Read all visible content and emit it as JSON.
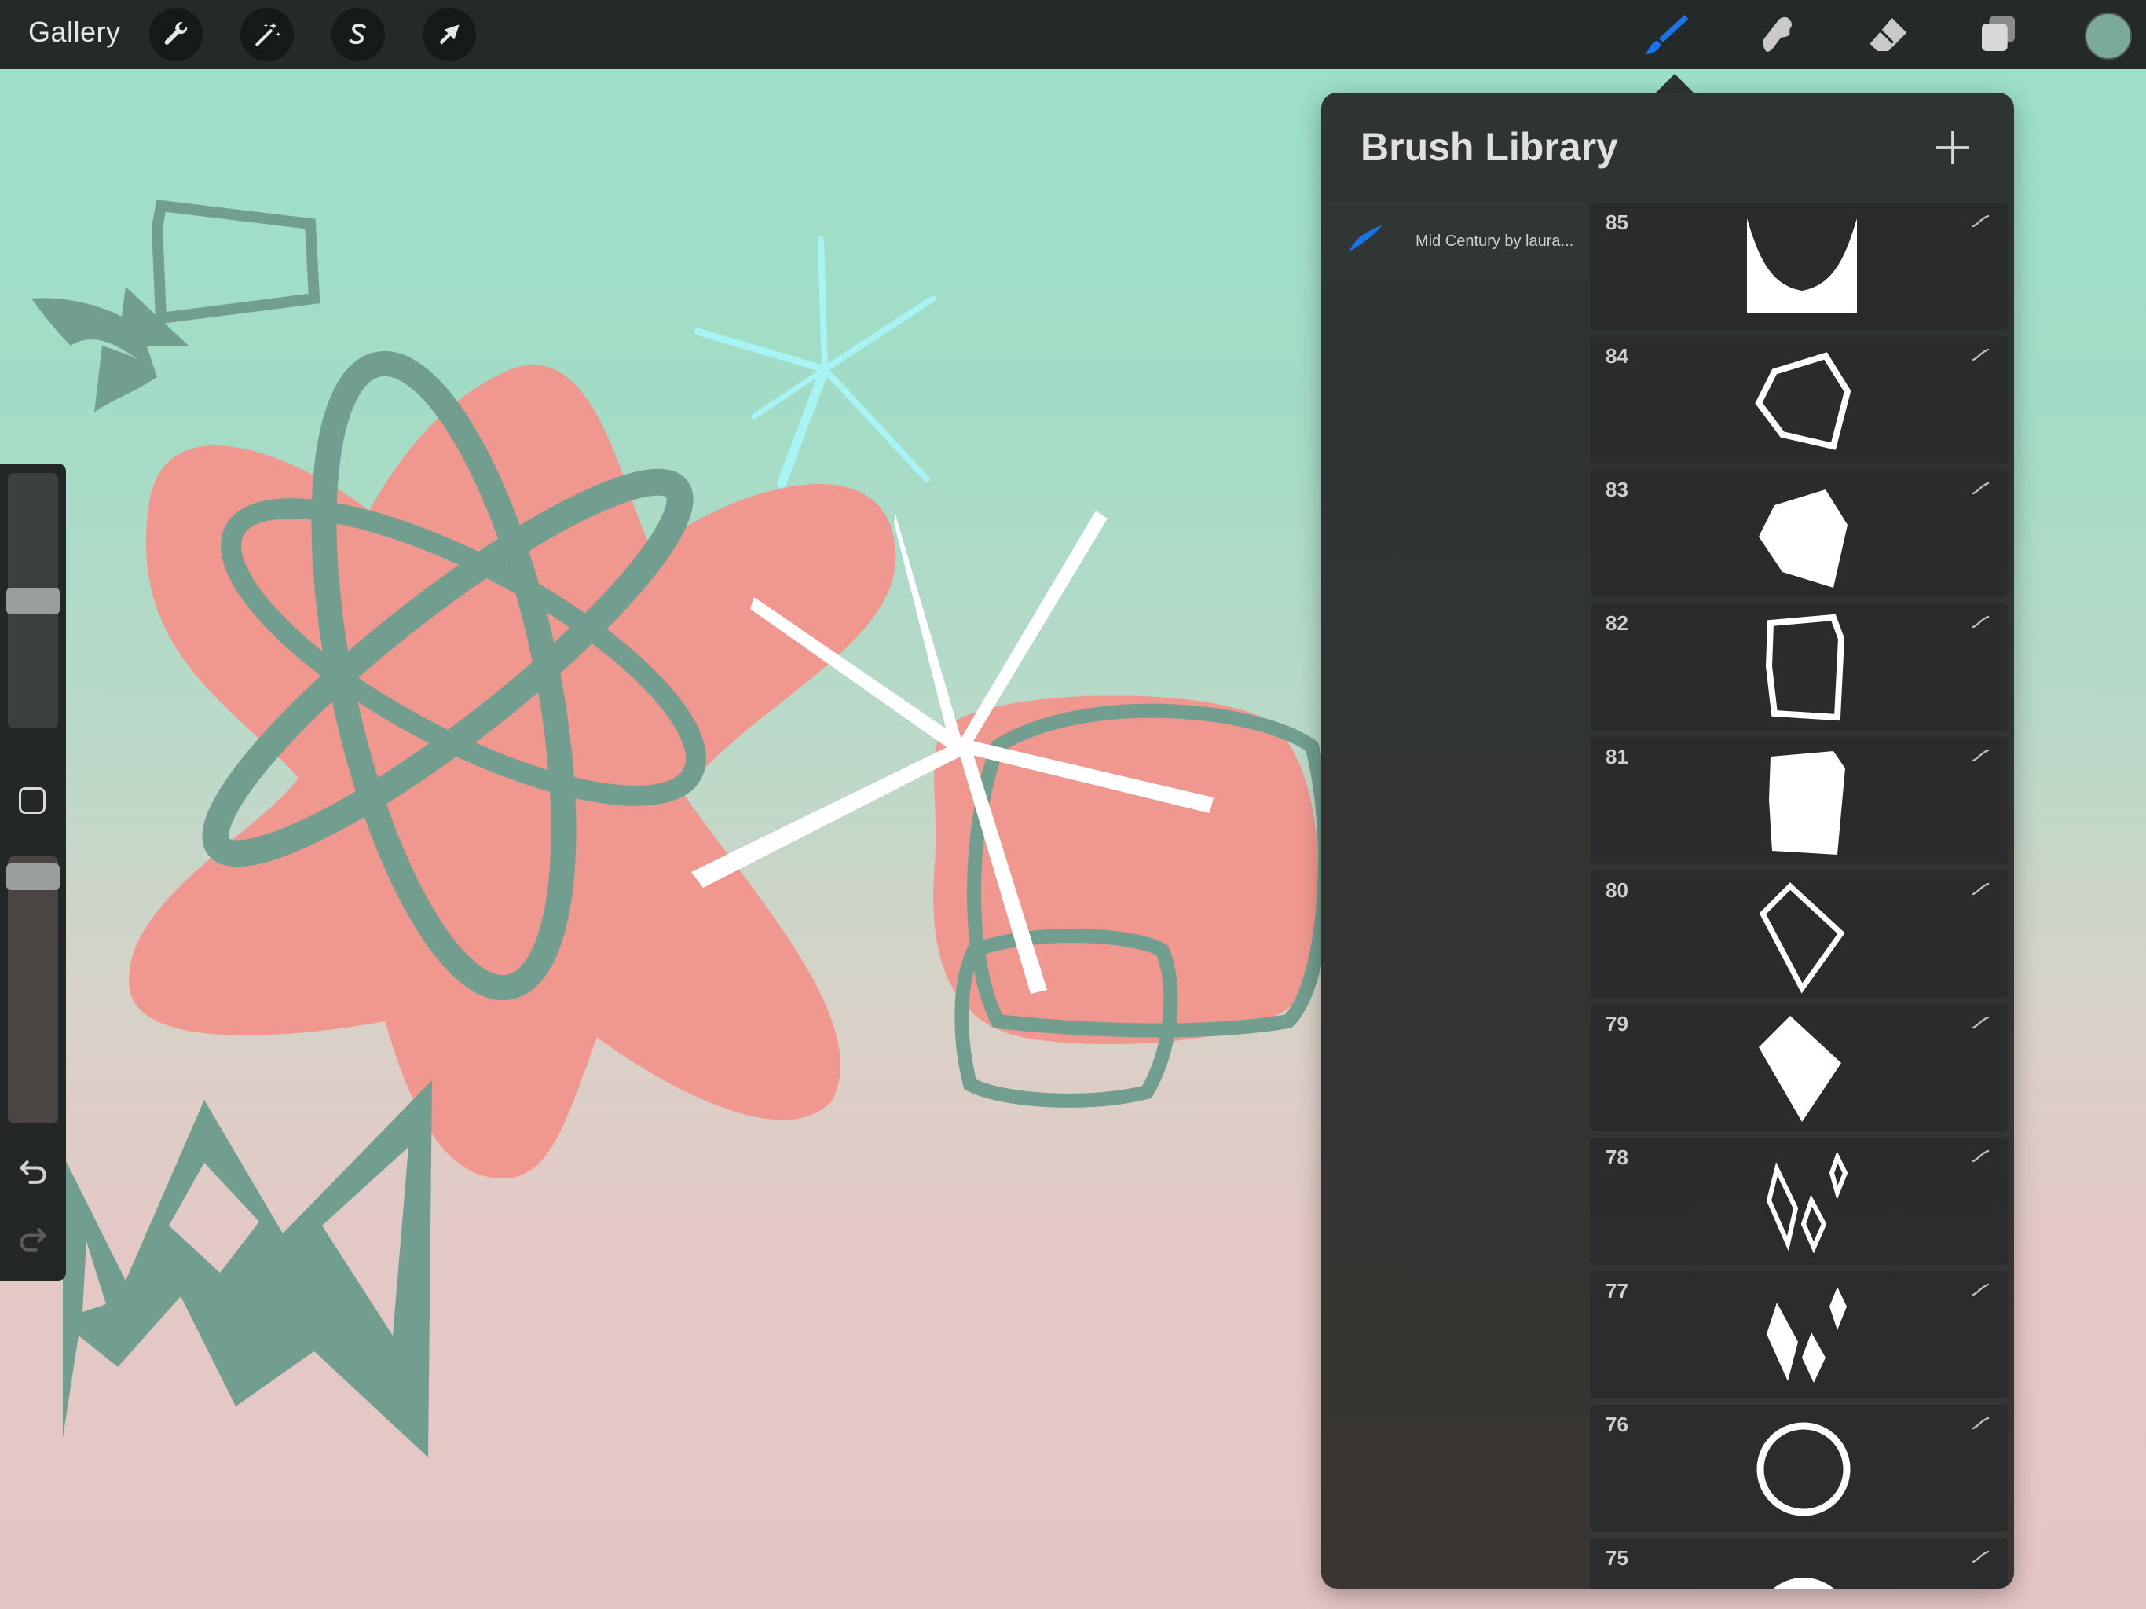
{
  "topbar": {
    "gallery_label": "Gallery",
    "left_tools": [
      "wrench-icon",
      "magic-wand-icon",
      "selection-s-icon",
      "arrow-transform-icon"
    ],
    "right_tools": [
      "brush-icon",
      "smudge-icon",
      "eraser-icon",
      "layers-icon"
    ],
    "active_tool": "brush-icon",
    "accent_color": "#1a73e8",
    "current_color": "#7aab99"
  },
  "sidebar": {
    "size_level": 0.5,
    "opacity_level": 0.97,
    "modify_icon": "square-icon",
    "undo_icon": "undo-icon",
    "redo_icon": "redo-icon"
  },
  "brush_library": {
    "title": "Brush Library",
    "add_icon": "plus-icon",
    "brush_set": {
      "name": "Mid Century by laura...",
      "icon": "brush-stroke-icon"
    },
    "brushes": [
      {
        "number": "85",
        "shape": "u-cup"
      },
      {
        "number": "84",
        "shape": "hexagon-outline"
      },
      {
        "number": "83",
        "shape": "hexagon-filled"
      },
      {
        "number": "82",
        "shape": "quad-outline"
      },
      {
        "number": "81",
        "shape": "quad-filled"
      },
      {
        "number": "80",
        "shape": "kite-outline"
      },
      {
        "number": "79",
        "shape": "kite-filled"
      },
      {
        "number": "78",
        "shape": "diamonds-outline"
      },
      {
        "number": "77",
        "shape": "diamonds-filled"
      },
      {
        "number": "76",
        "shape": "circle-outline"
      },
      {
        "number": "75",
        "shape": "circle-filled"
      }
    ]
  },
  "canvas": {
    "colors": {
      "teal": "#729e8f",
      "coral": "#f09890",
      "cyan": "#a8f4f4",
      "white": "#ffffff"
    }
  }
}
